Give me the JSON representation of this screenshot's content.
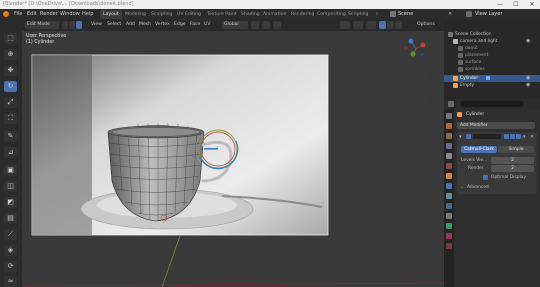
{
  "window": {
    "title": "[Blender* [D:\\OneDrive\\... [Downloads\\doneit.blend]",
    "minimize": "—",
    "maximize": "☐",
    "close": "✕"
  },
  "menu": [
    "File",
    "Edit",
    "Render",
    "Window",
    "Help"
  ],
  "workspaces": {
    "tabs": [
      "Layout",
      "Modeling",
      "Sculpting",
      "UV Editing",
      "Texture Paint",
      "Shading",
      "Animation",
      "Rendering",
      "Compositing",
      "Scripting"
    ],
    "active_index": 0,
    "scene_label": "Scene",
    "view_layer_label": "View Layer"
  },
  "viewport_header": {
    "mode": "Edit Mode",
    "menus": [
      "View",
      "Select",
      "Add",
      "Mesh",
      "Vertex",
      "Edge",
      "Face",
      "UV"
    ],
    "transform": "Global",
    "options": "Options"
  },
  "viewport": {
    "perspective": "User Perspective",
    "object": "(1) Cylinder"
  },
  "outliner": {
    "header": "Scene Collection",
    "items": [
      {
        "label": "Scene Collection",
        "indent": 0,
        "selected": false,
        "color": "#d8d8d8"
      },
      {
        "label": "camera and light",
        "indent": 1,
        "selected": false,
        "color": "#d8d8d8"
      },
      {
        "label": "donut",
        "indent": 2,
        "selected": false,
        "color": "#9a9a9a"
      },
      {
        "label": "placement",
        "indent": 2,
        "selected": false,
        "color": "#9a9a9a"
      },
      {
        "label": "surface",
        "indent": 2,
        "selected": false,
        "color": "#9a9a9a"
      },
      {
        "label": "sprinkles",
        "indent": 2,
        "selected": false,
        "color": "#9a9a9a"
      },
      {
        "label": "Cylinder",
        "indent": 1,
        "selected": true,
        "color": "#f0a050"
      },
      {
        "label": "Empty",
        "indent": 1,
        "selected": false,
        "color": "#f0a050"
      }
    ]
  },
  "properties": {
    "object_name": "Cylinder",
    "add_modifier": "Add Modifier",
    "subdiv_type_a": "Catmull-Clark",
    "subdiv_type_b": "Simple",
    "levels_viewport_label": "Levels Vie...",
    "levels_viewport_value": "2",
    "render_label": "Render",
    "render_value": "2",
    "optimal_display": "Optimal Display",
    "advanced": "Advanced"
  },
  "colors": {
    "accent": "#4a72b5",
    "selected_row": "#335a8c",
    "panel": "#2f2f2f"
  }
}
